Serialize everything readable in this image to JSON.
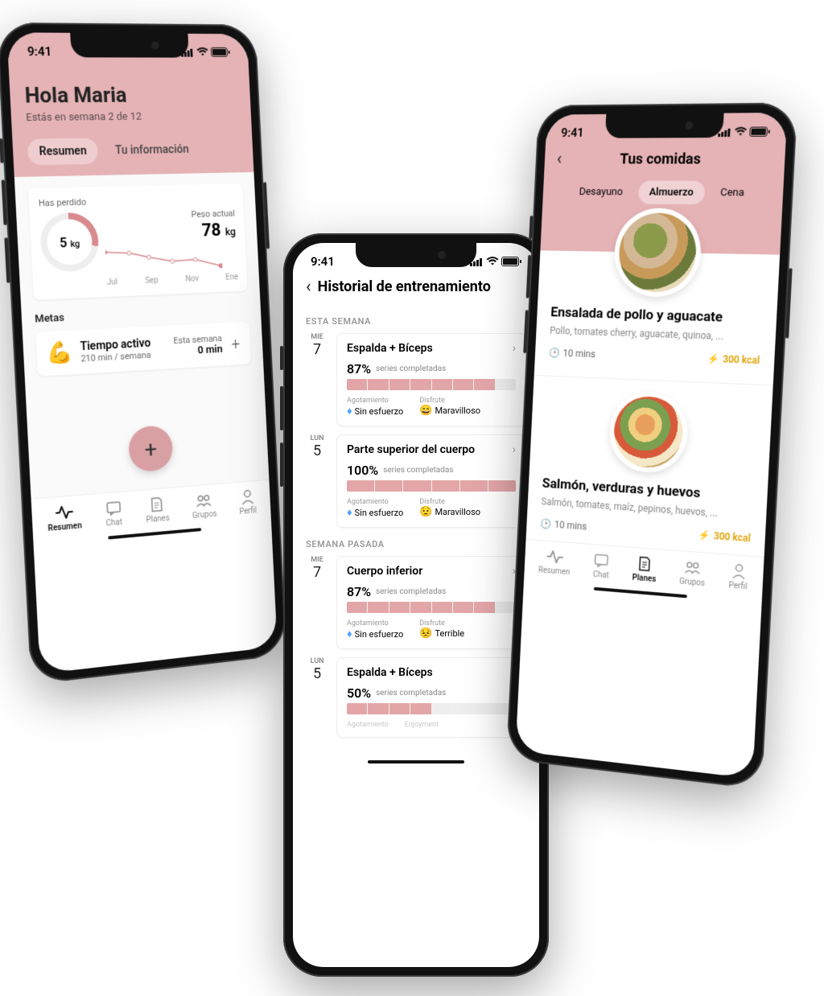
{
  "status_time": "9:41",
  "colors": {
    "accent": "#e5b3b5",
    "accent_dark": "#d88a8e"
  },
  "phone1": {
    "greeting": "Hola Maria",
    "subtitle": "Estás en semana 2 de 12",
    "tabs": {
      "summary": "Resumen",
      "info": "Tu información"
    },
    "lost_label": "Has perdido",
    "lost_value": "5",
    "lost_unit": "kg",
    "current_label": "Peso actual",
    "current_value": "78",
    "current_unit": "kg",
    "months": [
      "Jul",
      "Sep",
      "Nov",
      "Ene"
    ],
    "goals_heading": "Metas",
    "goal": {
      "emoji": "💪",
      "title": "Tiempo activo",
      "subtitle": "210 min / semana",
      "week_label": "Esta semana",
      "week_value": "0 min"
    },
    "nav": [
      "Resumen",
      "Chat",
      "Planes",
      "Grupos",
      "Perfil"
    ]
  },
  "phone2": {
    "title": "Historial de entrenamiento",
    "section1": "ESTA SEMANA",
    "section2": "SEMANA PASADA",
    "series_label": "series completadas",
    "exh_label": "Agotamiento",
    "enj_label": "Disfrute",
    "entries": [
      {
        "dow": "MIE",
        "day": "7",
        "name": "Espalda + Bíceps",
        "pct": "87%",
        "bars": 8,
        "filled": 7,
        "exh": "Sin esfuerzo",
        "enj": "Maravilloso",
        "enj_emoji": "😄"
      },
      {
        "dow": "LUN",
        "day": "5",
        "name": "Parte superior del cuerpo",
        "pct": "100%",
        "bars": 6,
        "filled": 6,
        "exh": "Sin esfuerzo",
        "enj": "Maravilloso",
        "enj_emoji": "😟"
      },
      {
        "dow": "MIE",
        "day": "7",
        "name": "Cuerpo inferior",
        "pct": "87%",
        "bars": 8,
        "filled": 7,
        "exh": "Sin esfuerzo",
        "enj": "Terrible",
        "enj_emoji": "😣"
      },
      {
        "dow": "LUN",
        "day": "5",
        "name": "Espalda + Bíceps",
        "pct": "50%",
        "bars": 8,
        "filled": 4,
        "exh": "",
        "enj": "",
        "enj_emoji": "",
        "partial": true,
        "exh_cut": "Agotamiento",
        "enj_cut": "Enjoyment"
      }
    ]
  },
  "phone3": {
    "title": "Tus comidas",
    "tabs": {
      "breakfast": "Desayuno",
      "lunch": "Almuerzo",
      "dinner": "Cena"
    },
    "meals": [
      {
        "name": "Ensalada de pollo y aguacate",
        "ingredients": "Pollo, tomates cherry, aguacate, quinoa, ...",
        "time": "10 mins",
        "kcal": "300 kcal"
      },
      {
        "name": "Salmón, verduras y huevos",
        "ingredients": "Salmón, tomates, maíz, pepinos, huevos, ...",
        "time": "10 mins",
        "kcal": "300 kcal"
      }
    ],
    "nav": [
      "Resumen",
      "Chat",
      "Planes",
      "Grupos",
      "Perfil"
    ]
  }
}
